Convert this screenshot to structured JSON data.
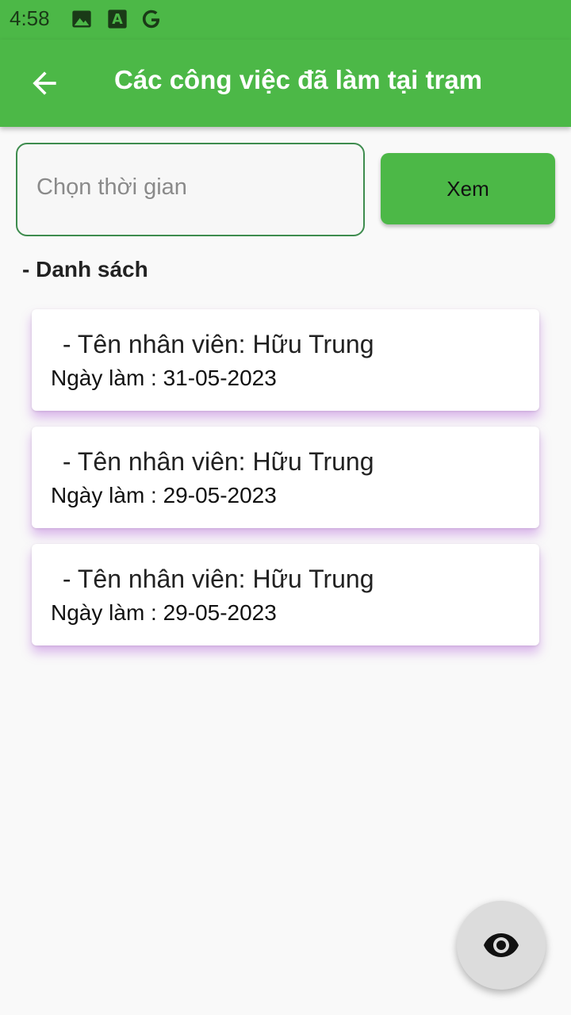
{
  "status_bar": {
    "time": "4:58",
    "icons": [
      "image-icon",
      "font-a-icon",
      "google-g-icon"
    ],
    "color": "#4cb847"
  },
  "app_bar": {
    "title": "Các công việc đã làm tại trạm",
    "back_icon": "arrow-left-icon",
    "color": "#4cb847"
  },
  "filter": {
    "placeholder": "Chọn thời gian",
    "button_label": "Xem"
  },
  "list": {
    "title": "- Danh sách",
    "items": [
      {
        "name": " - Tên nhân viên: Hữu Trung",
        "date": "Ngày làm : 31-05-2023"
      },
      {
        "name": " - Tên nhân viên: Hữu Trung",
        "date": "Ngày làm : 29-05-2023"
      },
      {
        "name": " - Tên nhân viên: Hữu Trung",
        "date": "Ngày làm : 29-05-2023"
      }
    ]
  },
  "fab": {
    "icon": "eye-icon"
  }
}
